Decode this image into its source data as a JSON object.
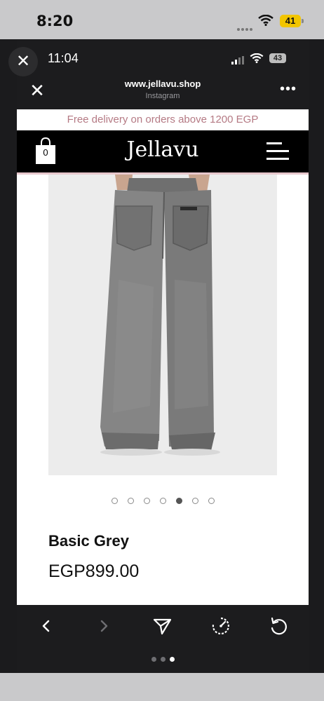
{
  "outer_status": {
    "time": "8:20",
    "battery": "41"
  },
  "inner_status": {
    "time": "11:04",
    "battery": "43"
  },
  "browser": {
    "url": "www.jellavu.shop",
    "source": "Instagram"
  },
  "site": {
    "promo": "Free delivery on orders above 1200 EGP",
    "logo": "Jellavu",
    "cart_count": "0"
  },
  "product": {
    "name": "Basic Grey",
    "price": "EGP899.00",
    "image_count": 7,
    "active_image_index": 4
  },
  "toolbar": {
    "page_indicator_count": 3,
    "page_indicator_active": 2
  }
}
